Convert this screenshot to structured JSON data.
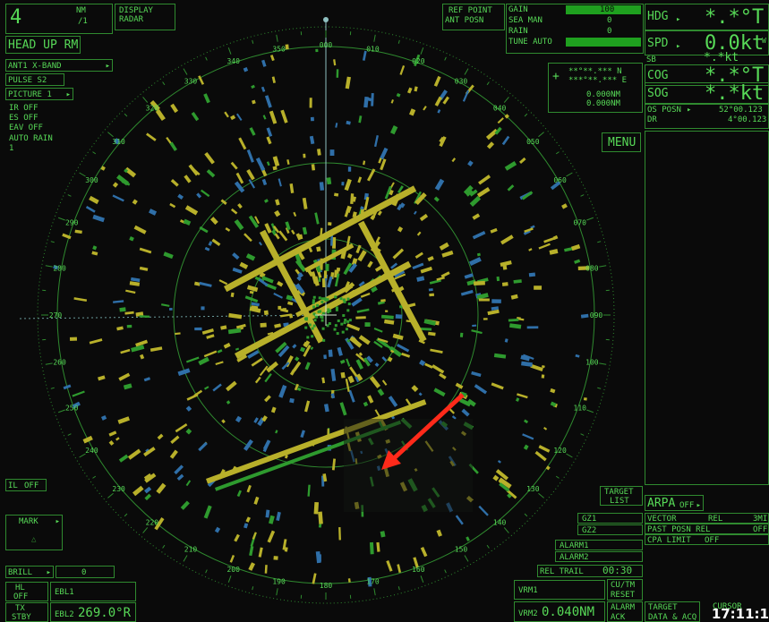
{
  "top_left": {
    "range": "4",
    "range_unit": "NM",
    "range_sub": "/1",
    "display_label_1": "DISPLAY",
    "display_label_2": "RADAR",
    "mode": "HEAD UP RM"
  },
  "left_panel": {
    "antenna": "ANT1  X-BAND",
    "pulse": "PULSE S2",
    "picture": "PICTURE 1",
    "ir": "IR  OFF",
    "es": "ES  OFF",
    "eav": "EAV OFF",
    "auto_rain": "AUTO RAIN",
    "auto_rain_val": "1",
    "il": "IL",
    "il_val": "OFF",
    "mark": "MARK",
    "mark_symbol": "△",
    "brill": "BRILL",
    "brill_val": "0"
  },
  "bottom_left": {
    "hl": "HL",
    "hl_val": "OFF",
    "tx": "TX",
    "tx_val": "STBY",
    "ebl1": "EBL1",
    "ebl2": "EBL2",
    "ebl2_val": "269.0°R"
  },
  "ref_point": {
    "label1": "REF POINT",
    "label2": "ANT  POSN"
  },
  "gain_panel": {
    "gain": "GAIN",
    "gain_val": "100",
    "sea": "SEA  MAN",
    "sea_val": "0",
    "rain": "RAIN",
    "rain_val": "0",
    "tune": "TUNE AUTO"
  },
  "cursor_box": {
    "lat": "**°**.*** N",
    "lon": "***°**.*** E",
    "range1": "0.000NM",
    "range2": "0.000NM"
  },
  "nav_data": {
    "hdg_label": "HDG",
    "hdg_val": "*.*°T",
    "spd_label": "SPD",
    "spd_val": "0.0kt",
    "spd_suffix": "W",
    "sb_label": "SB",
    "sb_val": "*.*kt",
    "cog_label": "COG",
    "cog_val": "*.*°T",
    "sog_label": "SOG",
    "sog_val": "*.*kt",
    "os_posn": "OS POSN",
    "dr": "DR",
    "lat": "52°00.123",
    "lon": "4°00.123"
  },
  "menu_label": "MENU",
  "right_bottom": {
    "target_list_1": "TARGET",
    "target_list_2": "LIST",
    "arpa": "ARPA",
    "arpa_val": "OFF",
    "vector": "VECTOR",
    "vector_val": "REL",
    "vector_time": "3MI",
    "past_posn": "PAST POSN REL",
    "past_posn_val": "OFF",
    "cpa_limit": "CPA LIMIT",
    "cpa_limit_val": "OFF",
    "gz1": "GZ1",
    "gz2": "GZ2",
    "alarm1": "ALARM1",
    "alarm2": "ALARM2",
    "rel_trail": "REL  TRAIL",
    "rel_trail_val": "00:30",
    "cu_tm_1": "CU/TM",
    "cu_tm_2": "RESET",
    "alarm_ack_1": "ALARM",
    "alarm_ack_2": "ACK",
    "target_data_1": "TARGET",
    "target_data_2": "DATA & ACQ",
    "cursor": "CURSOR",
    "vrm1": "VRM1",
    "vrm2": "VRM2",
    "vrm2_val": "0.040NM",
    "clock": "17:11:1"
  },
  "bearing_labels": [
    "000",
    "010",
    "020",
    "030",
    "040",
    "050",
    "060",
    "070",
    "080",
    "090",
    "100",
    "110",
    "120",
    "130",
    "140",
    "150",
    "160",
    "170",
    "180",
    "190",
    "200",
    "210",
    "220",
    "230",
    "240",
    "250",
    "260",
    "270",
    "280",
    "290",
    "300",
    "310",
    "320",
    "330",
    "340",
    "350"
  ],
  "colors": {
    "text": "#57d957",
    "border": "#2f8a2f",
    "echo_yellow": "#b8b02a",
    "echo_green": "#2e9a2e",
    "echo_blue": "#2f6fa8",
    "arrow": "#ff2a1a"
  }
}
